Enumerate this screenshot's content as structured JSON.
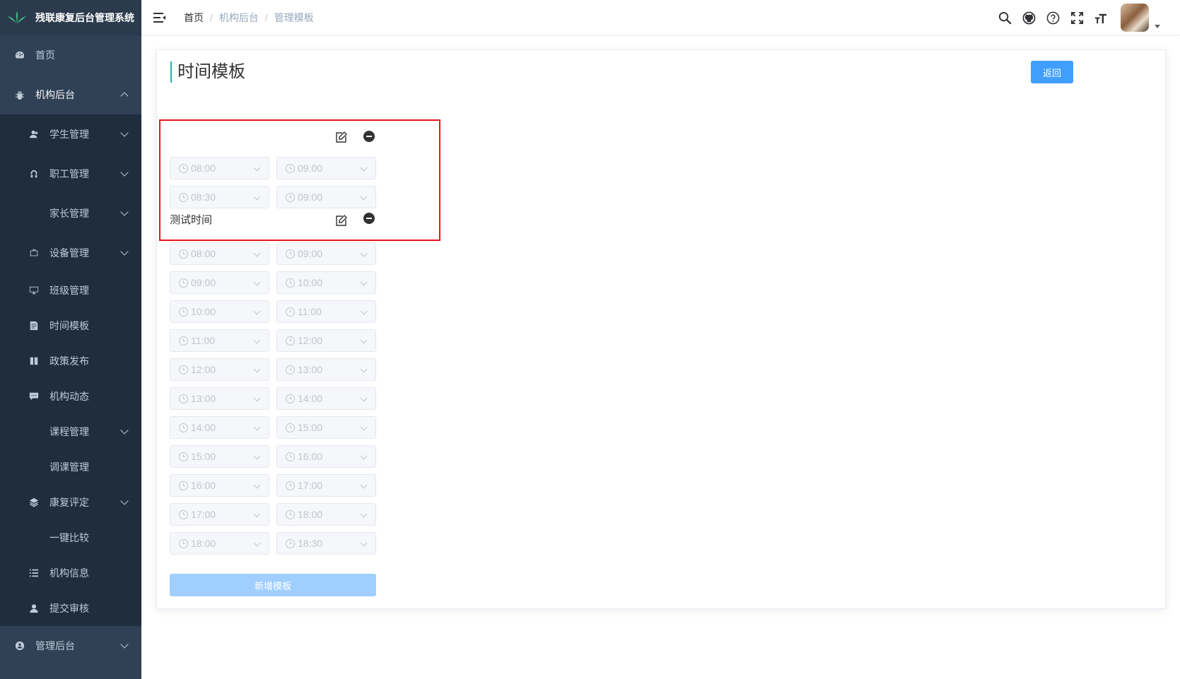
{
  "app": {
    "title": "残联康复后台管理系统"
  },
  "sidebar": {
    "home": "首页",
    "org_backend": "机构后台",
    "org_items": {
      "students": "学生管理",
      "staff": "职工管理",
      "parents": "家长管理",
      "devices": "设备管理",
      "classes": "班级管理",
      "time_template": "时间模板",
      "policy": "政策发布",
      "news": "机构动态",
      "courses": "课程管理",
      "reschedule": "调课管理",
      "assessment": "康复评定",
      "compare": "一键比较",
      "org_info": "机构信息",
      "submit_review": "提交审核"
    },
    "admin_backend": "管理后台"
  },
  "breadcrumb": {
    "home": "首页",
    "org": "机构后台",
    "current": "管理模板"
  },
  "page": {
    "title": "时间模板",
    "back_label": "返回",
    "add_label": "新增模板"
  },
  "templates": [
    {
      "name": "",
      "slots": [
        {
          "start": "08:00",
          "end": "09:00"
        },
        {
          "start": "08:30",
          "end": "09:00"
        }
      ]
    },
    {
      "name": "测试时间",
      "slots": [
        {
          "start": "08:00",
          "end": "09:00"
        },
        {
          "start": "09:00",
          "end": "10:00"
        },
        {
          "start": "10:00",
          "end": "11:00"
        },
        {
          "start": "11:00",
          "end": "12:00"
        },
        {
          "start": "12:00",
          "end": "13:00"
        },
        {
          "start": "13:00",
          "end": "14:00"
        },
        {
          "start": "14:00",
          "end": "15:00"
        },
        {
          "start": "15:00",
          "end": "16:00"
        },
        {
          "start": "16:00",
          "end": "17:00"
        },
        {
          "start": "17:00",
          "end": "18:00"
        },
        {
          "start": "18:00",
          "end": "18:30"
        }
      ]
    }
  ],
  "colors": {
    "sidebar_bg": "#304156",
    "primary": "#409eff",
    "highlight": "#e8141a",
    "title_accent": "#1fb5ad"
  },
  "icons": [
    "search-icon",
    "github-icon",
    "help-icon",
    "fullscreen-icon",
    "font-size-icon"
  ]
}
